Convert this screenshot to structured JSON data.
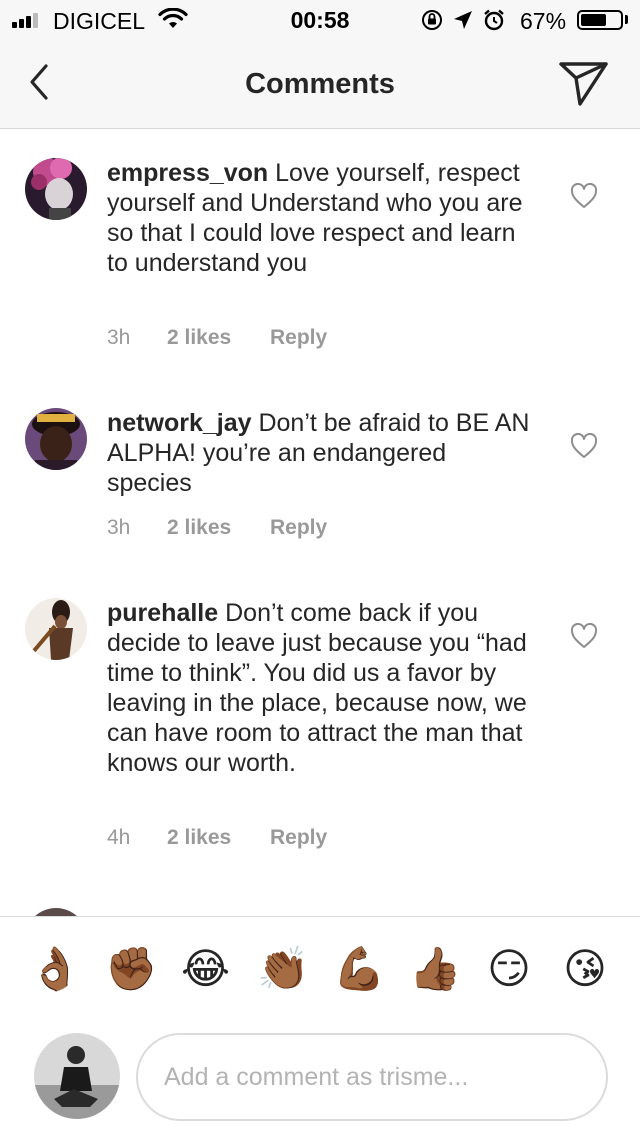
{
  "status_bar": {
    "carrier": "DIGICEL",
    "time": "00:58",
    "battery_percent": "67%",
    "battery_level": 0.67,
    "icons": [
      "signal-icon",
      "wifi-icon",
      "rotation-lock-icon",
      "location-icon",
      "alarm-icon",
      "battery-icon"
    ]
  },
  "header": {
    "title": "Comments",
    "back_icon": "chevron-left-icon",
    "send_icon": "direct-send-icon"
  },
  "comments": [
    {
      "username": "empress_von",
      "text": "Love yourself, respect yourself and Understand who you are so that I could love respect and learn to understand you",
      "time": "3h",
      "likes": "2 likes",
      "reply": "Reply"
    },
    {
      "username": "network_jay",
      "text": "Don’t be afraid to BE AN ALPHA! you’re an endangered species",
      "time": "3h",
      "likes": "2 likes",
      "reply": "Reply"
    },
    {
      "username": "purehalle",
      "text": "Don’t come back if you decide to leave just because you “had time to think”. You did us a favor by leaving in the place, because now, we can have room to attract the man that knows our worth.",
      "time": "4h",
      "likes": "2 likes",
      "reply": "Reply"
    }
  ],
  "emoji_bar": [
    "👌🏾",
    "✊🏾",
    "😂",
    "👏🏾",
    "💪🏾",
    "👍🏾",
    "😏",
    "😘"
  ],
  "composer": {
    "placeholder": "Add a comment as trisme..."
  },
  "colors": {
    "text": "#262626",
    "meta": "#999999",
    "header_bg": "#f7f7f7",
    "divider": "#dbdbdb"
  }
}
